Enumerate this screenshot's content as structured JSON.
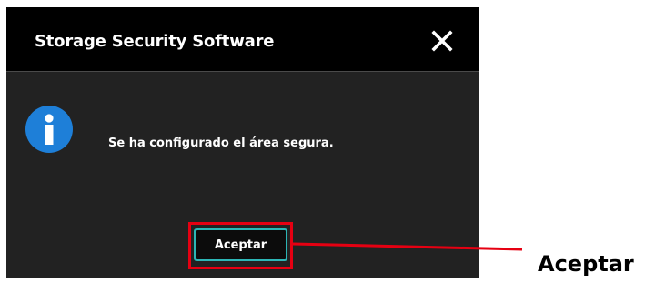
{
  "dialog": {
    "title": "Storage Security Software",
    "message": "Se ha configurado el área segura.",
    "ok_label": "Aceptar"
  },
  "annotation": {
    "label": "Aceptar",
    "color": "#e60012"
  },
  "icons": {
    "close": "close-icon",
    "info": "info-icon"
  },
  "colors": {
    "titlebar": "#000000",
    "dialog_body": "#222222",
    "info_icon": "#1e7fd8",
    "button_border": "#2cb6b6"
  }
}
